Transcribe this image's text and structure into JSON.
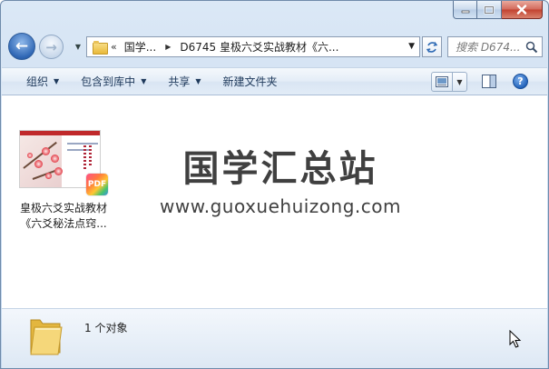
{
  "window": {
    "controls": {
      "minimize": "minimize",
      "maximize": "maximize",
      "close": "close"
    }
  },
  "address_bar": {
    "overflow": "«",
    "segments": [
      "国学...",
      "D6745 皇极六爻实战教材《六..."
    ],
    "search_placeholder": "搜索 D674..."
  },
  "toolbar": {
    "organize": "组织",
    "include_in_library": "包含到库中",
    "share": "共享",
    "new_folder": "新建文件夹"
  },
  "files": [
    {
      "name_line1": "皇极六爻实战教材",
      "name_line2": "《六爻秘法点窍...",
      "badge": "PDF",
      "type": "pdf"
    }
  ],
  "watermark": {
    "title": "国学汇总站",
    "url": "www.guoxuehuizong.com"
  },
  "details": {
    "count_text": "1 个对象"
  },
  "colors": {
    "accent": "#2f67b5",
    "command_text": "#1e395b",
    "close_button": "#c2422f"
  }
}
